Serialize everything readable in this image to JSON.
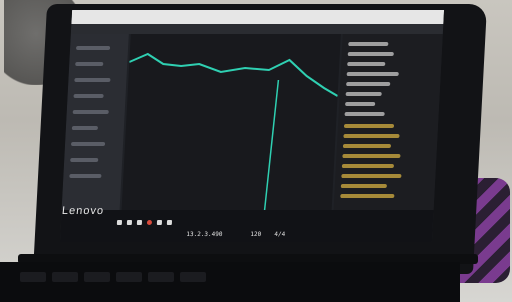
{
  "photo": {
    "laptop_brand": "Lenovo",
    "screen": {
      "bottom_readouts": {
        "position": "13.2.3.490",
        "number": "120",
        "count": "4/4"
      }
    }
  },
  "colors": {
    "accent_line": "#2fd0b2",
    "tree_folder": "#c9a640"
  }
}
